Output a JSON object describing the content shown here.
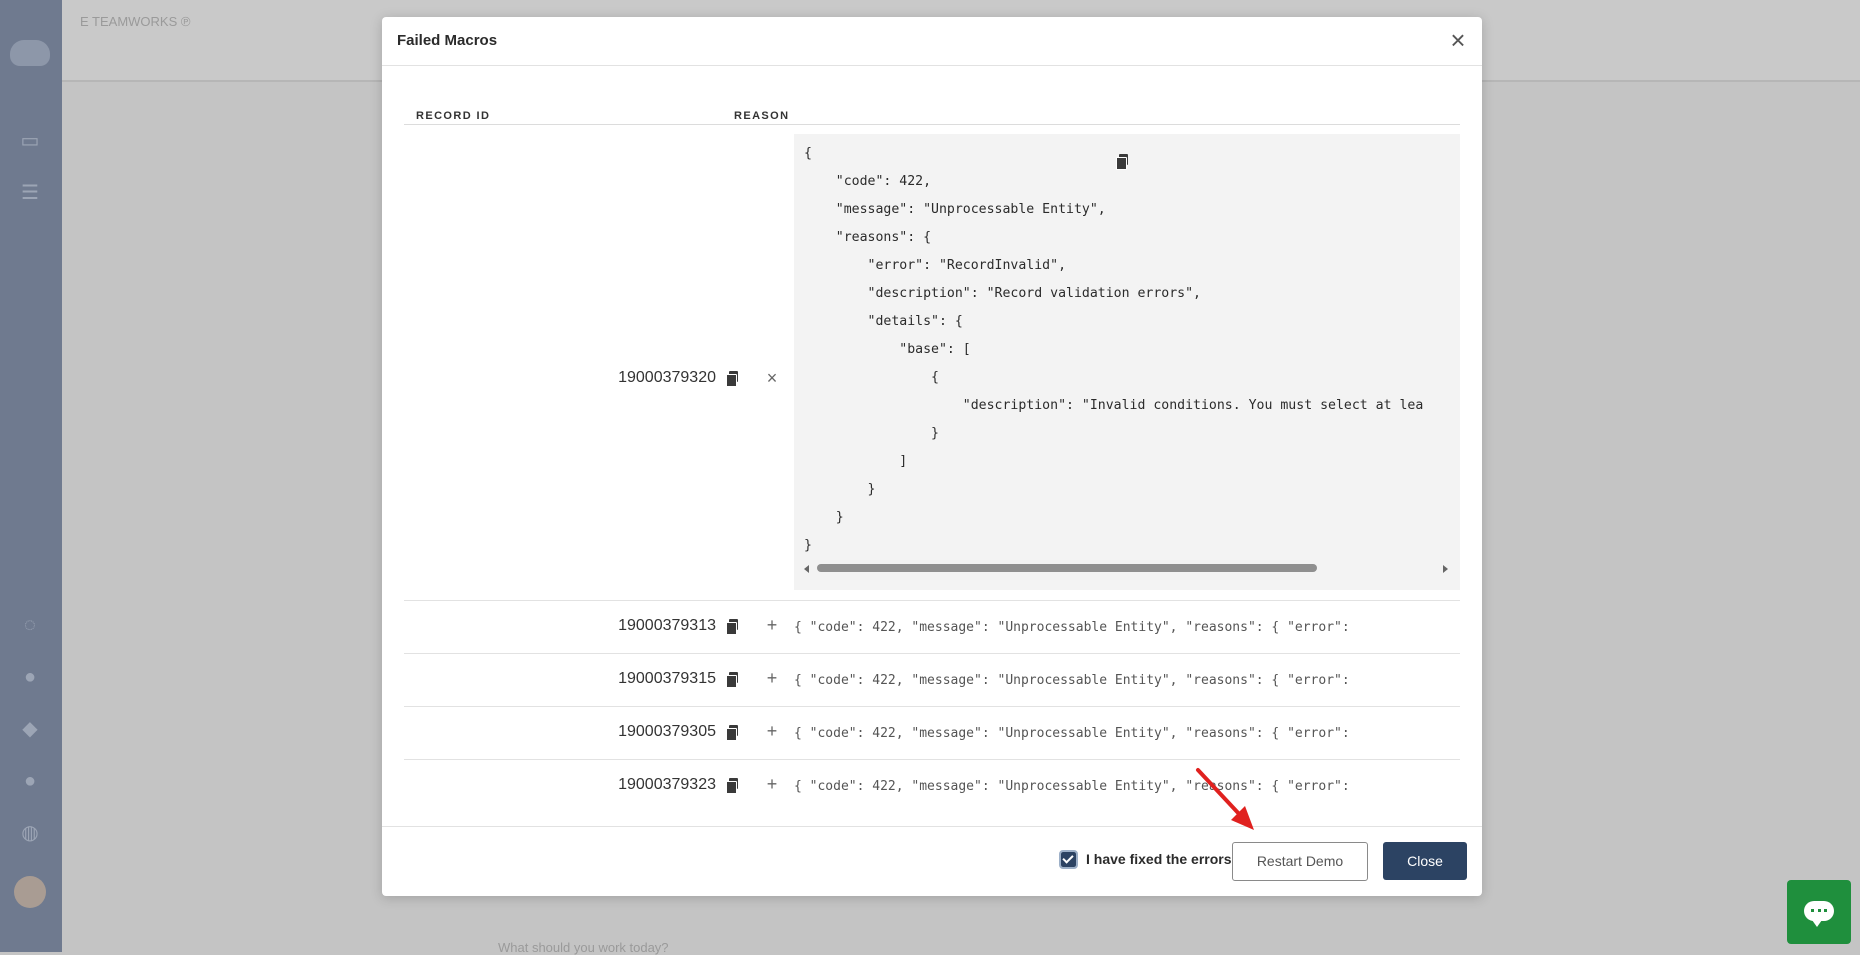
{
  "background": {
    "title": "E TEAMWORKS ℗",
    "footer_hint": "What should you work today?"
  },
  "modal": {
    "title": "Failed Macros",
    "columns": {
      "record_id": "RECORD ID",
      "reason": "REASON"
    },
    "expanded_row": {
      "record_id": "19000379320",
      "toggle": "×",
      "json_text": "{\n    \"code\": 422,\n    \"message\": \"Unprocessable Entity\",\n    \"reasons\": {\n        \"error\": \"RecordInvalid\",\n        \"description\": \"Record validation errors\",\n        \"details\": {\n            \"base\": [\n                {\n                    \"description\": \"Invalid conditions. You must select at lea\n                }\n            ]\n        }\n    }\n}"
    },
    "rows": [
      {
        "record_id": "19000379313",
        "toggle": "+",
        "preview": "{ \"code\": 422, \"message\": \"Unprocessable Entity\", \"reasons\": { \"error\":"
      },
      {
        "record_id": "19000379315",
        "toggle": "+",
        "preview": "{ \"code\": 422, \"message\": \"Unprocessable Entity\", \"reasons\": { \"error\":"
      },
      {
        "record_id": "19000379305",
        "toggle": "+",
        "preview": "{ \"code\": 422, \"message\": \"Unprocessable Entity\", \"reasons\": { \"error\":"
      },
      {
        "record_id": "19000379323",
        "toggle": "+",
        "preview": "{ \"code\": 422, \"message\": \"Unprocessable Entity\", \"reasons\": { \"error\":"
      }
    ],
    "footer": {
      "checkbox_label": "I have fixed the errors",
      "checkbox_checked": true,
      "restart_label": "Restart Demo",
      "close_label": "Close"
    }
  },
  "colors": {
    "primary": "#2c4363",
    "annotation_arrow": "#e0211f",
    "chat_widget": "#1f8f3d"
  }
}
